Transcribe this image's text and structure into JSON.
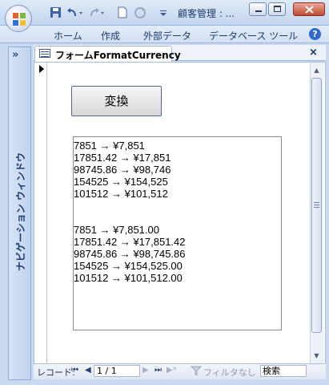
{
  "window": {
    "title": "顧客管理 : ...",
    "brand_colors": {
      "title_text": "#1e3c6e",
      "close_red": "#c04a2e"
    }
  },
  "quick_access": {
    "icons": [
      "save-icon",
      "undo-icon",
      "redo-icon",
      "new-doc-icon",
      "refresh-icon",
      "customize-dropdown-icon"
    ]
  },
  "ribbon": {
    "tabs": [
      "ホーム",
      "作成",
      "外部データ",
      "データベース ツール"
    ]
  },
  "nav_pane": {
    "toggle": "»",
    "label": "ナビゲーション ウィンドウ"
  },
  "document": {
    "tab_label": "フォームFormatCurrency",
    "close": "×"
  },
  "form": {
    "button_label": "変換",
    "output_lines": [
      "7851 → ¥7,851",
      "17851.42 → ¥17,851",
      "98745.86 → ¥98,746",
      "154525 → ¥154,525",
      "101512 → ¥101,512",
      "",
      "",
      "7851 → ¥7,851.00",
      "17851.42 → ¥17,851.42",
      "98745.86 → ¥98,745.86",
      "154525 → ¥154,525.00",
      "101512 → ¥101,512.00"
    ]
  },
  "record_nav": {
    "label": "レコード:",
    "first": "⏮",
    "prev": "◀",
    "position": "1 / 1",
    "next": "▶",
    "last": "⏭",
    "new": "▶*",
    "filter": "フィルタなし",
    "search": "検索"
  }
}
